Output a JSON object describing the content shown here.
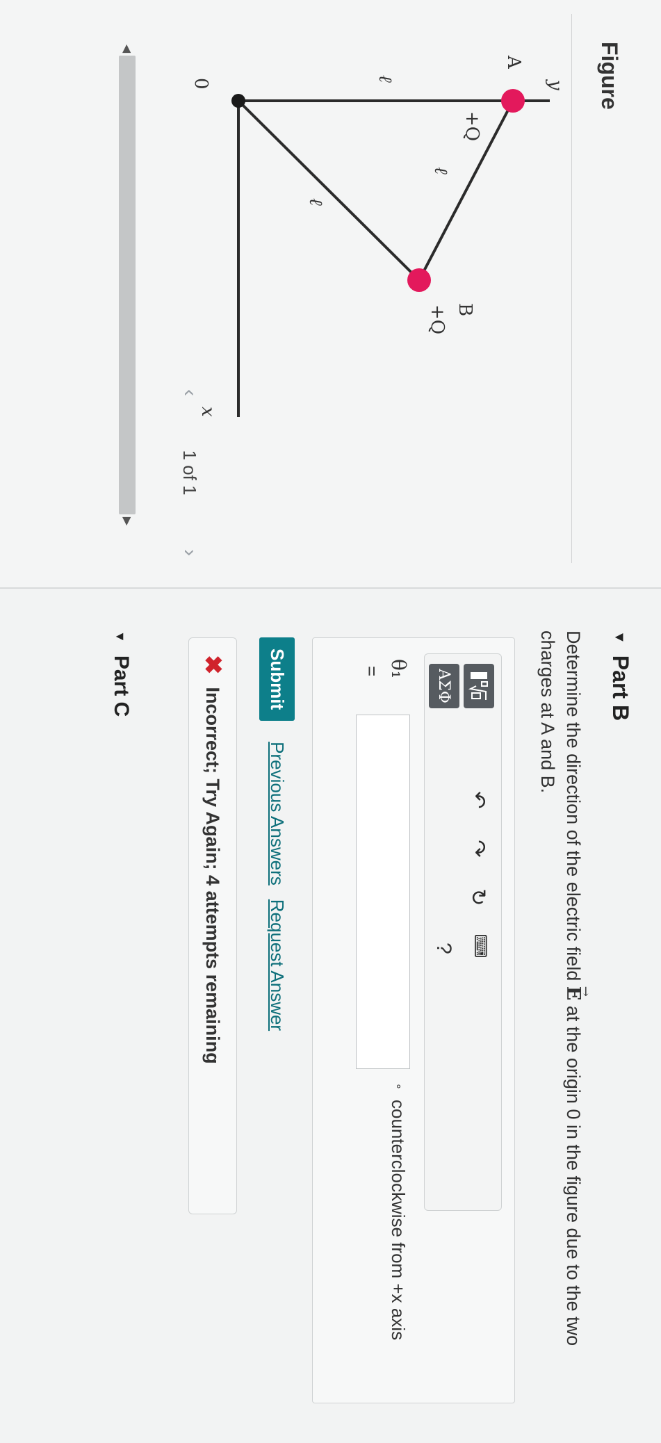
{
  "figure": {
    "title": "Figure",
    "pager": {
      "text": "1 of 1"
    },
    "diagram": {
      "axis_y": "y",
      "axis_x": "x",
      "origin": "0",
      "point_a": "A",
      "point_b": "B",
      "charge_a": "+Q",
      "charge_b": "+Q",
      "length": "ℓ",
      "charge_color": "#e3195c"
    }
  },
  "part_b": {
    "title": "Part B",
    "question_pre": "Determine the direction of the electric field ",
    "field_symbol": "E",
    "question_post": " at the origin 0 in the figure due to the two charges at A and B.",
    "toolbar": {
      "greek_label": "ΑΣΦ",
      "template_icon": "templates-icon",
      "help_label": "?"
    },
    "answer": {
      "label": "θ₁",
      "equals": "=",
      "value": "",
      "unit_degree": "∘",
      "unit_text": "counterclockwise from +x axis"
    },
    "submit_label": "Submit",
    "previous_answers_label": "Previous Answers",
    "request_answer_label": "Request Answer",
    "feedback": "Incorrect; Try Again; 4 attempts remaining",
    "feedback_color": "#d0232c"
  },
  "part_c": {
    "title": "Part C"
  },
  "accent_color": "#0d7f8a"
}
